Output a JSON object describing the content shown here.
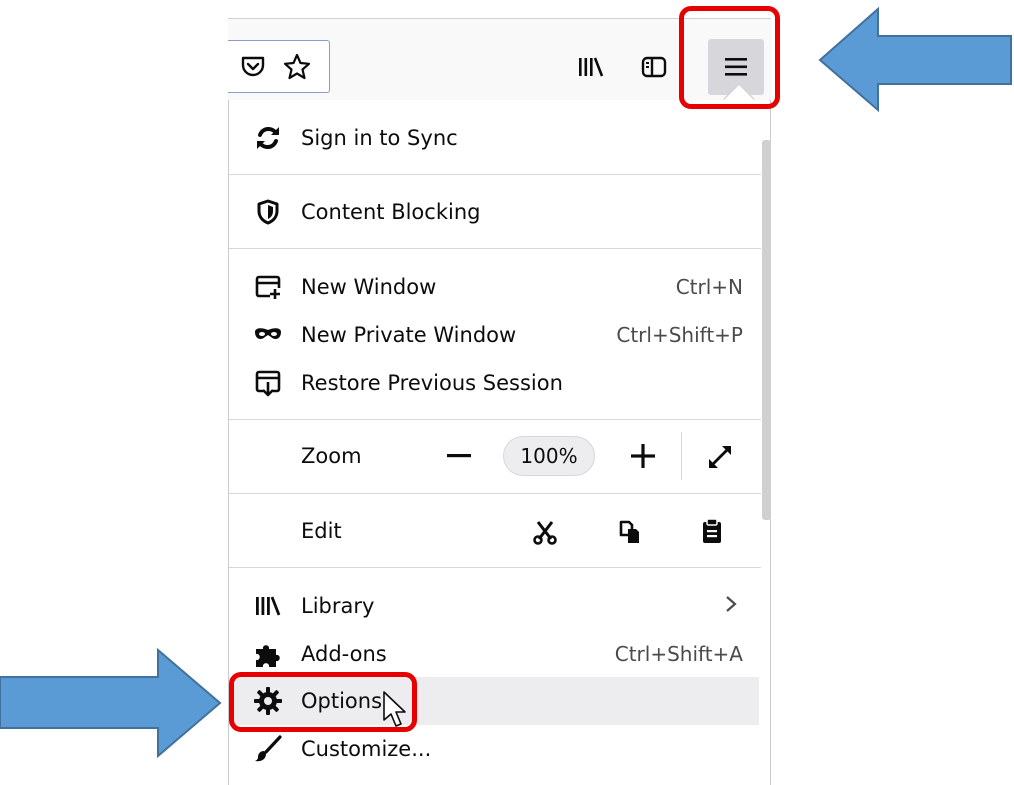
{
  "toolbar": {
    "pocket_icon": "pocket-icon",
    "bookmark_icon": "star-icon",
    "library_icon": "library-icon",
    "sidebar_icon": "sidebar-icon",
    "menu_icon": "hamburger-icon"
  },
  "menu": {
    "sync_label": "Sign in to Sync",
    "content_blocking_label": "Content Blocking",
    "new_window_label": "New Window",
    "new_window_shortcut": "Ctrl+N",
    "private_window_label": "New Private Window",
    "private_window_shortcut": "Ctrl+Shift+P",
    "restore_session_label": "Restore Previous Session",
    "zoom_label": "Zoom",
    "zoom_value": "100%",
    "edit_label": "Edit",
    "library_label": "Library",
    "addons_label": "Add-ons",
    "addons_shortcut": "Ctrl+Shift+A",
    "options_label": "Options",
    "customize_label": "Customize..."
  },
  "colors": {
    "highlight_box": "#e60000",
    "arrow_fill": "#5b9bd5",
    "arrow_stroke": "#41719c"
  }
}
